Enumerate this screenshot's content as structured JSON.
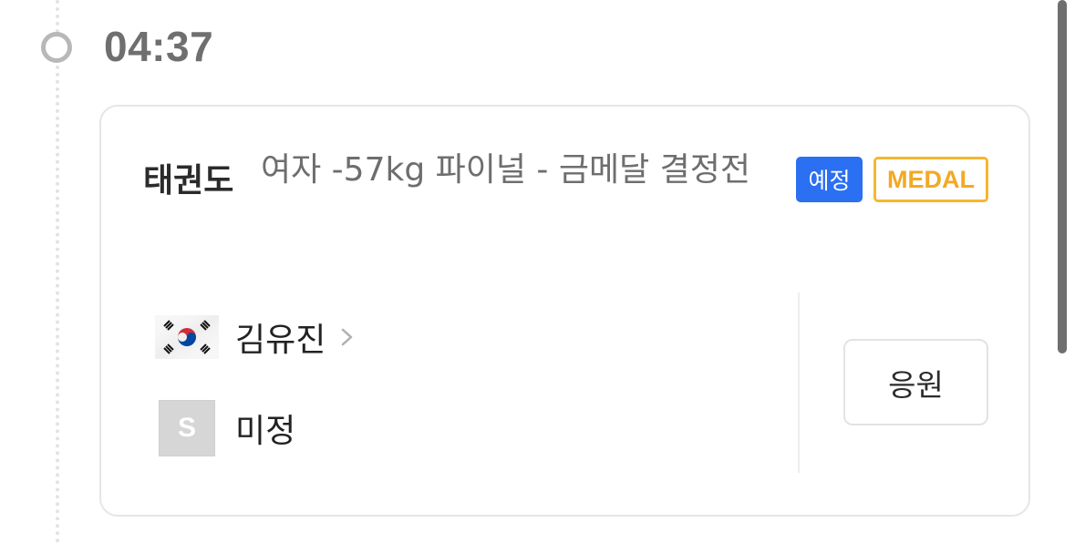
{
  "time": "04:37",
  "event": {
    "sport": "태권도",
    "title": "여자 -57kg 파이널 - 금메달 결정전",
    "status_badge": "예정",
    "medal_badge": "MEDAL"
  },
  "competitors": [
    {
      "name": "김유진",
      "flag_icon": "korea-flag-icon",
      "has_link": true
    },
    {
      "name": "미정",
      "flag_icon": "placeholder-flag-icon",
      "placeholder_letter": "S",
      "has_link": false
    }
  ],
  "actions": {
    "cheer_label": "응원"
  },
  "colors": {
    "status_badge_bg": "#2b6ff3",
    "medal_badge": "#f5b731",
    "time_text": "#6f6f6f"
  }
}
